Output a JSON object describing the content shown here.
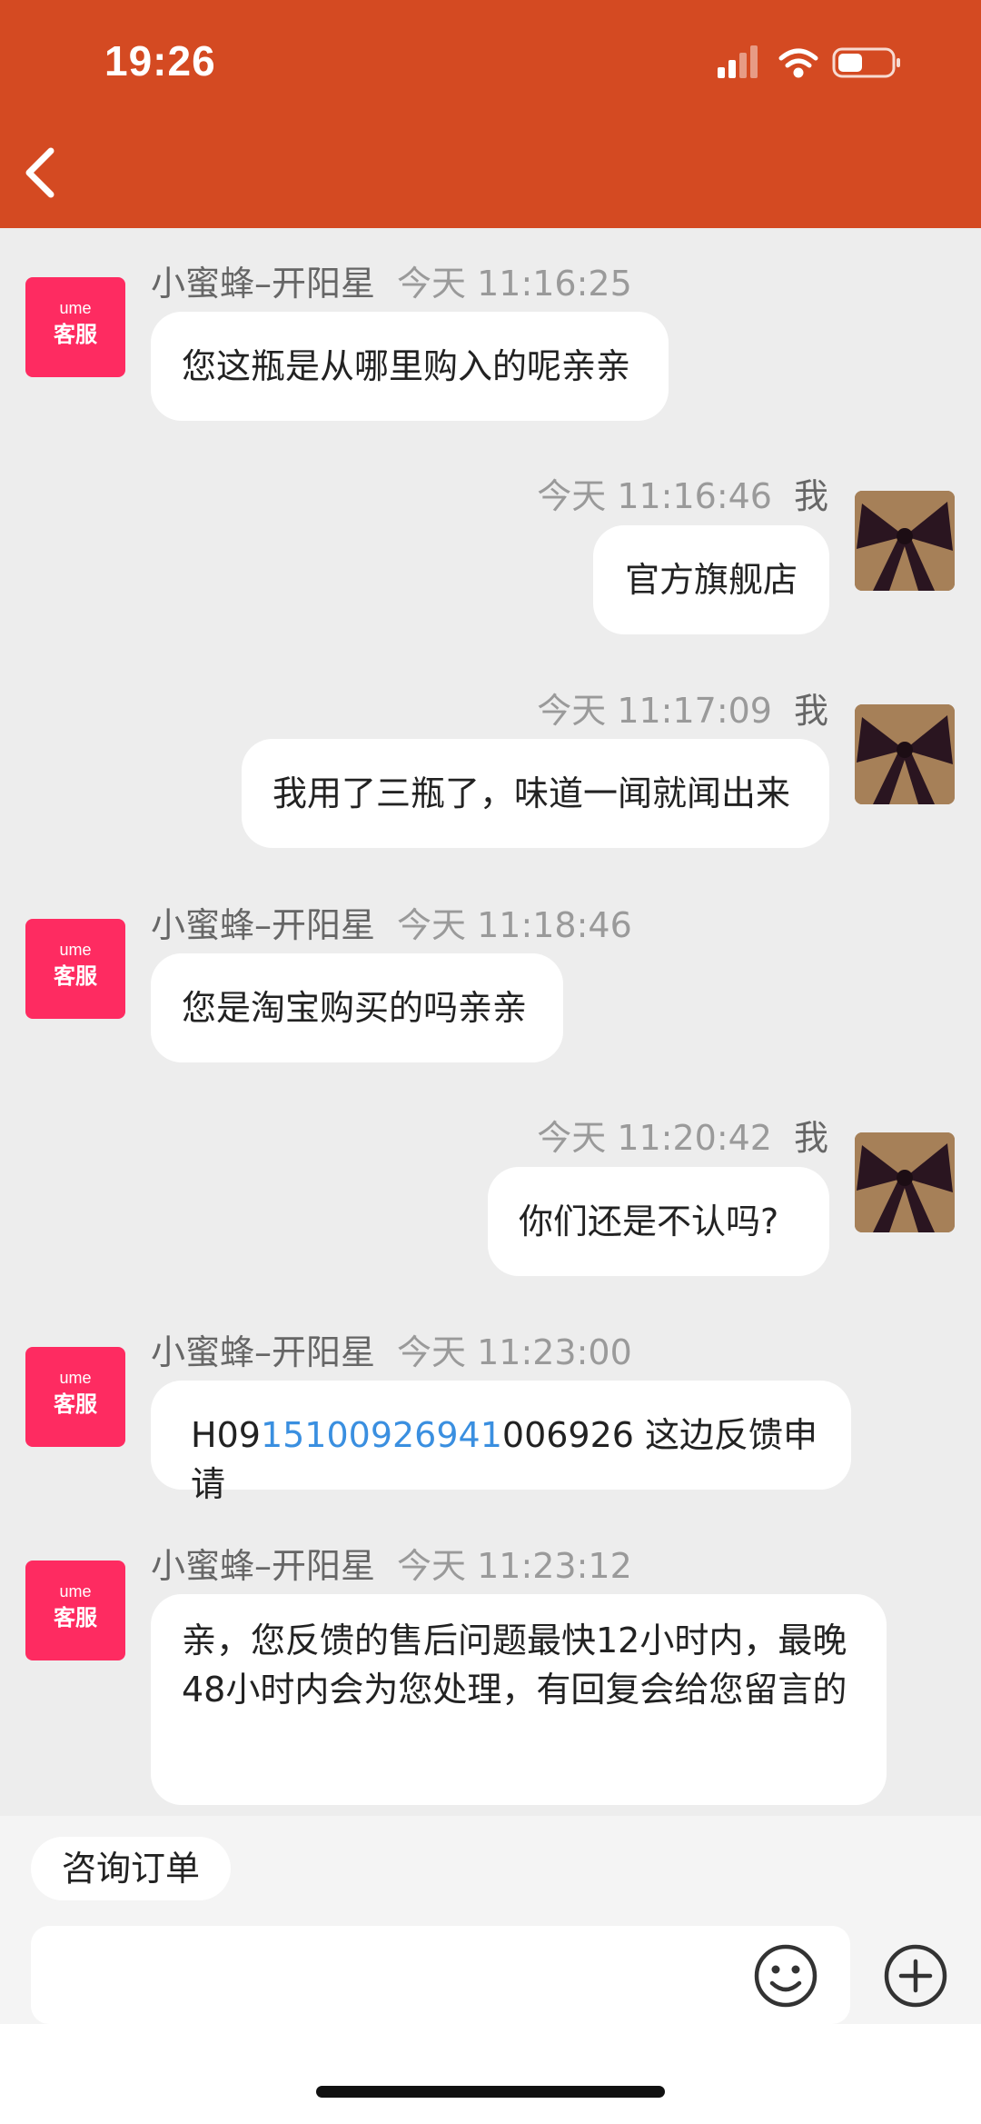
{
  "status_bar": {
    "time": "19:26"
  },
  "header": {
    "back_icon": "chevron-left-icon",
    "color": "#d44a22"
  },
  "messages": [
    {
      "side": "left",
      "sender": "小蜜蜂–开阳星",
      "timestamp": "今天 11:16:25",
      "text": "您这瓶是从哪里购入的呢亲亲"
    },
    {
      "side": "right",
      "sender": "我",
      "timestamp": "今天 11:16:46",
      "text": "官方旗舰店"
    },
    {
      "side": "right",
      "sender": "我",
      "timestamp": "今天 11:17:09",
      "text": "我用了三瓶了，味道一闻就闻出来"
    },
    {
      "side": "left",
      "sender": "小蜜蜂–开阳星",
      "timestamp": "今天 11:18:46",
      "text": "您是淘宝购买的吗亲亲"
    },
    {
      "side": "right",
      "sender": "我",
      "timestamp": "今天 11:20:42",
      "text": "你们还是不认吗?"
    },
    {
      "side": "left",
      "sender": "小蜜蜂–开阳星",
      "timestamp": "今天 11:23:00",
      "text_prefix": "H09",
      "text_link": "15100926941",
      "text_suffix": "006926 这边反馈申请"
    },
    {
      "side": "left",
      "sender": "小蜜蜂–开阳星",
      "timestamp": "今天 11:23:12",
      "text": "亲，您反馈的售后问题最快12小时内，最晚48小时内会为您处理，有回复会给您留言的"
    }
  ],
  "cs_avatar": {
    "brand": "ume",
    "label": "客服",
    "color": "#fe2b61"
  },
  "bottom": {
    "quick_reply": "咨询订单",
    "emoji_icon": "smiley-icon",
    "plus_icon": "plus-circle-icon"
  }
}
